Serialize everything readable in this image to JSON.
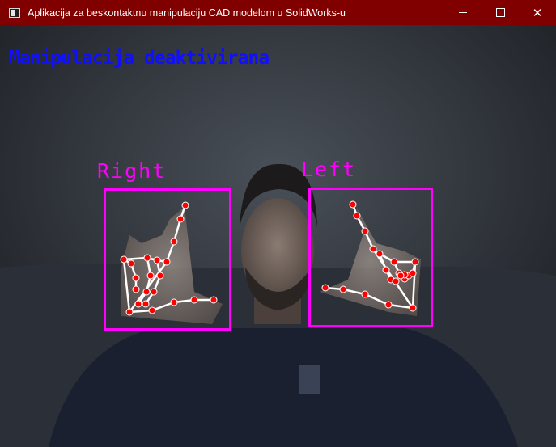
{
  "window": {
    "title": "Aplikacija za beskontaktnu manipulaciju CAD modelom u SolidWorks-u",
    "controls": {
      "minimize_icon": "minimize-icon",
      "maximize_icon": "maximize-icon",
      "close_icon": "close-icon",
      "close_glyph": "✕"
    },
    "titlebar_color": "#800000"
  },
  "camera": {
    "status_text": "Manipulacija deaktivirana",
    "status_color": "#1010ff",
    "hands": [
      {
        "label": "Right",
        "color": "#ff00ff"
      },
      {
        "label": "Left",
        "color": "#ff00ff"
      }
    ],
    "landmark_color": "#ff0000",
    "connection_color": "#ffffff"
  }
}
